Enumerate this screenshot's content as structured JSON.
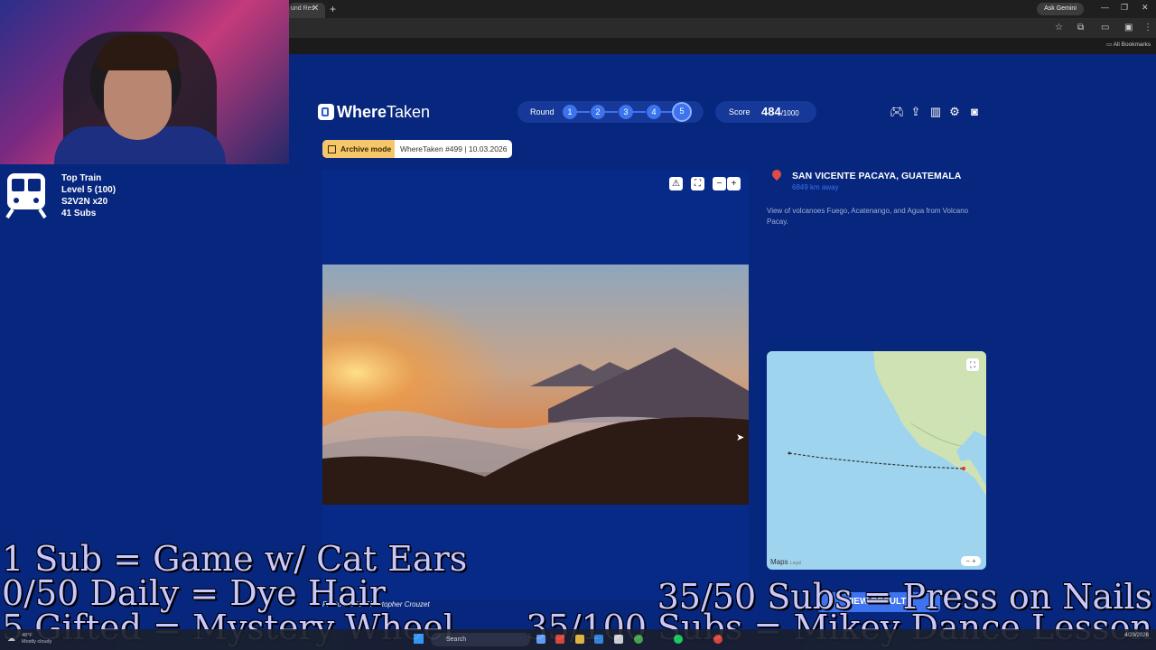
{
  "browser": {
    "tab_label": "und Res",
    "ask_gemini": "Ask Gemini",
    "all_bookmarks": "All Bookmarks"
  },
  "train_widget": {
    "line1": "Top Train",
    "line2": "Level 5  (100)",
    "line3": "S2V2N x20",
    "line4": "41 Subs"
  },
  "app": {
    "brand_bold": "Where",
    "brand_rest": "Taken",
    "round_label": "Round",
    "rounds": [
      "1",
      "2",
      "3",
      "4",
      "5"
    ],
    "current_round": 5,
    "score_label": "Score",
    "score_value": "484",
    "score_max": "/1000",
    "archive_label": "Archive mode",
    "archive_info": "WhereTaken #499 | 10.03.2026",
    "location_name": "SAN VICENTE PACAYA, GUATEMALA",
    "location_distance": "6849 km away",
    "location_description": "View of volcanoes Fuego, Acatenango, and Agua from Volcano Pacay.",
    "photo_credit": "Photo credit: Christopher Crouzet",
    "map_brand": "Maps",
    "map_legal": "Legal",
    "results_button": "VIEW RESULTS"
  },
  "overlays": {
    "line1": "1 Sub = Game w/ Cat Ears",
    "line2": "0/50 Daily = Dye Hair",
    "line3": "5 Gifted = Mystery Wheel",
    "line4": "35/50 Subs = Press on Nails",
    "line5": "35/100 Subs = Mikey Dance Lesson"
  },
  "taskbar": {
    "weather_temp": "48°F",
    "weather_desc": "Mostly cloudy",
    "search_placeholder": "Search",
    "date": "4/29/2026"
  },
  "colors": {
    "page_bg": "#07267d",
    "accent": "#3d73ef",
    "archive_tag": "#f5c76a",
    "overlay_text": "#c9c7ff"
  }
}
